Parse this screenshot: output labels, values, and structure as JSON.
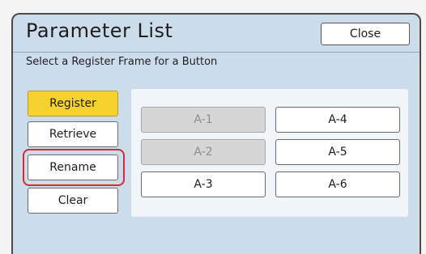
{
  "header": {
    "title": "Parameter List",
    "close_label": "Close"
  },
  "instruction": "Select a Register Frame for a Button",
  "actions": [
    {
      "label": "Register",
      "state": "selected"
    },
    {
      "label": "Retrieve",
      "state": "normal"
    },
    {
      "label": "Rename",
      "state": "highlighted"
    },
    {
      "label": "Clear",
      "state": "normal"
    }
  ],
  "slots": [
    {
      "label": "A-1",
      "enabled": false
    },
    {
      "label": "A-2",
      "enabled": false
    },
    {
      "label": "A-3",
      "enabled": true
    },
    {
      "label": "A-4",
      "enabled": true
    },
    {
      "label": "A-5",
      "enabled": true
    },
    {
      "label": "A-6",
      "enabled": true
    }
  ],
  "colors": {
    "panel_background": "#ccdcea",
    "selected_button": "#f7d12d",
    "highlight_ring": "#d92b2b",
    "disabled_slot": "#d6d6d6"
  }
}
